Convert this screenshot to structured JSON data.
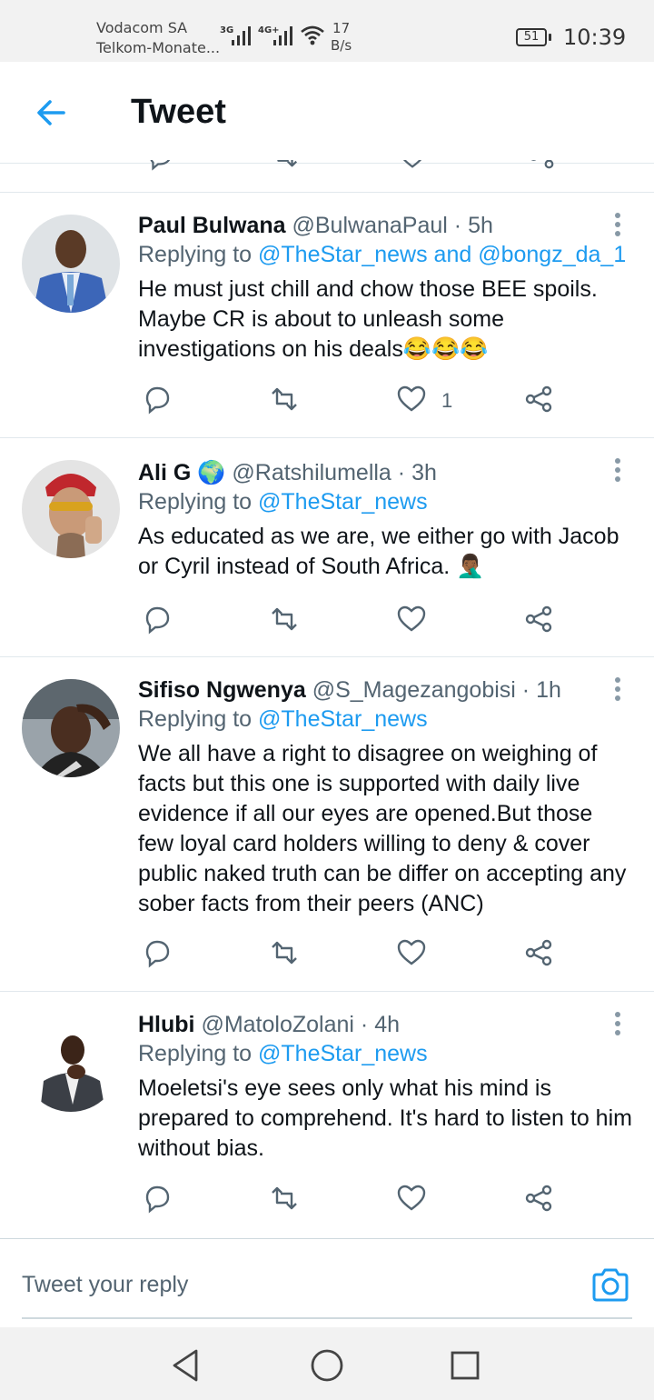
{
  "status_bar": {
    "carrier_1": "Vodacom SA",
    "carrier_2": "Telkom-Monate...",
    "net_1": "3G",
    "net_2": "4G+",
    "speed_value": "17",
    "speed_unit": "B/s",
    "battery": "51",
    "time": "10:39"
  },
  "header": {
    "title": "Tweet"
  },
  "tweets": [
    {
      "name": "Paul Bulwana",
      "handle": "@BulwanaPaul",
      "time": "5h",
      "replying_prefix": "Replying to ",
      "replying_to": "@TheStar_news and @bongz_da_1",
      "text": "He must just chill and chow those BEE spoils. Maybe CR is about to unleash some investigations on his deals😂😂😂",
      "likes": "1"
    },
    {
      "name": "Ali G",
      "badge": "🌍",
      "handle": "@Ratshilumella",
      "time": "3h",
      "replying_prefix": "Replying to ",
      "replying_to": "@TheStar_news",
      "text": "As educated as we are, we either go with Jacob or Cyril instead of South Africa. 🤦🏾‍♂️"
    },
    {
      "name": "Sifiso Ngwenya",
      "handle": "@S_Magezangobisi",
      "time": "1h",
      "replying_prefix": "Replying to ",
      "replying_to": "@TheStar_news",
      "text": "We all have a right to disagree on weighing of facts but this one  is supported with daily  live evidence if all our eyes are opened.But those few loyal  card holders willing to deny & cover public naked truth can be  differ on accepting any sober facts from their peers (ANC)"
    },
    {
      "name": "Hlubi",
      "handle": "@MatoloZolani",
      "time": "4h",
      "replying_prefix": "Replying to ",
      "replying_to": "@TheStar_news",
      "text": "Moeletsi's eye sees only what his mind is prepared to comprehend. It's hard to listen to him without bias."
    }
  ],
  "reply_bar": {
    "placeholder": "Tweet your reply"
  },
  "colors": {
    "accent": "#1d9bf0",
    "text": "#0f1419",
    "secondary": "#536471",
    "divider": "#e1e8ed"
  },
  "icons": [
    "back-arrow-icon",
    "reply-icon",
    "retweet-icon",
    "like-icon",
    "share-icon",
    "more-icon",
    "camera-icon",
    "nav-back-icon",
    "nav-home-icon",
    "nav-recents-icon"
  ]
}
